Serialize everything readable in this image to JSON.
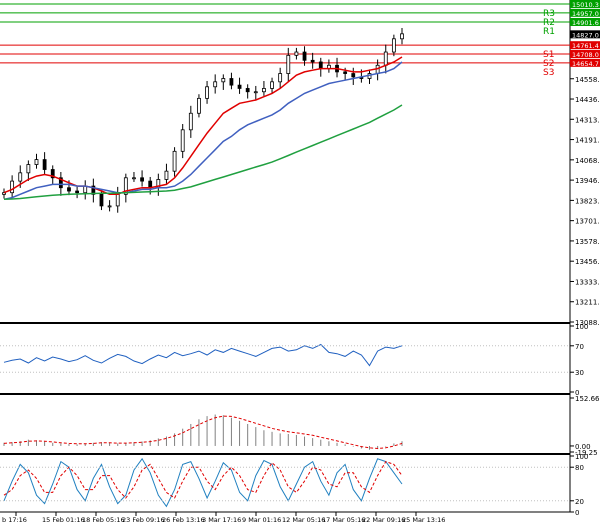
{
  "chart_data": [
    {
      "type": "line",
      "panel": "price",
      "x": [
        "b 17:16",
        "15 Feb 01:16",
        "18 Feb 05:16",
        "23 Feb 09:16",
        "26 Feb 13:16",
        "3 Mar 17:16",
        "9 Mar 01:16",
        "12 Mar 05:16",
        "17 Mar 05:16",
        "22 Mar 09:16",
        "25 Mar 13:16"
      ],
      "ylim": [
        13088.5,
        15010.3
      ],
      "yticks": [
        14558.5,
        14436.0,
        14313.5,
        14191.0,
        14068.5,
        13946.0,
        13823.5,
        13701.0,
        13578.5,
        13456.0,
        13333.5,
        13211.0,
        13088.5
      ],
      "price_bid_label": "14827.0",
      "series": [
        {
          "values": [
            13870,
            13940,
            13990,
            14040,
            14070,
            14010,
            13960,
            13900,
            13880,
            13870,
            13910,
            13860,
            13790,
            13790,
            13860,
            13960,
            13960,
            13940,
            13900,
            13950,
            14000,
            14120,
            14250,
            14350,
            14440,
            14510,
            14540,
            14560,
            14520,
            14500,
            14480,
            14480,
            14500,
            14540,
            14590,
            14700,
            14720,
            14670,
            14660,
            14620,
            14640,
            14600,
            14590,
            14570,
            14560,
            14590,
            14640,
            14720,
            14800,
            14830
          ]
        },
        {
          "values": [
            13870,
            13890,
            13920,
            13950,
            13970,
            13980,
            13970,
            13950,
            13930,
            13910,
            13910,
            13900,
            13880,
            13860,
            13860,
            13880,
            13890,
            13900,
            13900,
            13910,
            13920,
            13960,
            14020,
            14090,
            14160,
            14230,
            14290,
            14350,
            14380,
            14410,
            14420,
            14430,
            14450,
            14470,
            14500,
            14540,
            14580,
            14600,
            14610,
            14620,
            14620,
            14620,
            14610,
            14600,
            14600,
            14610,
            14620,
            14640,
            14660,
            14690
          ]
        },
        {
          "values": [
            13830,
            13840,
            13860,
            13880,
            13900,
            13910,
            13920,
            13920,
            13920,
            13910,
            13910,
            13900,
            13890,
            13880,
            13870,
            13870,
            13880,
            13890,
            13890,
            13900,
            13900,
            13910,
            13940,
            13980,
            14030,
            14080,
            14130,
            14180,
            14210,
            14250,
            14280,
            14300,
            14320,
            14340,
            14370,
            14410,
            14440,
            14470,
            14490,
            14510,
            14530,
            14540,
            14550,
            14560,
            14570,
            14580,
            14590,
            14600,
            14620,
            14660
          ]
        },
        {
          "values": [
            13830,
            13832,
            13835,
            13840,
            13845,
            13850,
            13855,
            13858,
            13860,
            13862,
            13864,
            13865,
            13866,
            13867,
            13868,
            13870,
            13872,
            13874,
            13876,
            13878,
            13880,
            13885,
            13895,
            13905,
            13920,
            13935,
            13950,
            13965,
            13980,
            13995,
            14010,
            14025,
            14040,
            14055,
            14075,
            14095,
            14115,
            14135,
            14155,
            14175,
            14195,
            14215,
            14235,
            14255,
            14275,
            14295,
            14320,
            14345,
            14370,
            14400
          ]
        }
      ],
      "levels": [
        {
          "label": "R3",
          "value": 15010.3,
          "tag": "15010.3",
          "color": "#00a000"
        },
        {
          "label": "R2",
          "value": 14957.0,
          "tag": "14957.0",
          "color": "#00a000"
        },
        {
          "label": "R1",
          "value": 14901.6,
          "tag": "14901.6",
          "color": "#00a000"
        },
        {
          "label": "S1",
          "value": 14761.4,
          "tag": "14761.4",
          "color": "#e00000"
        },
        {
          "label": "S2",
          "value": 14708.0,
          "tag": "14708.0",
          "color": "#e00000"
        },
        {
          "label": "S3",
          "value": 14654.7,
          "tag": "14654.7",
          "color": "#e00000"
        }
      ],
      "colors": {
        "candle": "#000000",
        "ma_fast": "#e00000",
        "ma_mid": "#4060c0",
        "ma_slow": "#20a040",
        "level_tag_text": "#ffffff",
        "bid_tag_bg": "#000000"
      }
    },
    {
      "type": "line",
      "panel": "oscillator-1",
      "ylim": [
        0,
        100
      ],
      "yticks": [
        "100",
        "70",
        "30",
        "0"
      ],
      "series": [
        {
          "values": [
            45,
            48,
            50,
            44,
            52,
            47,
            53,
            50,
            46,
            49,
            55,
            48,
            44,
            51,
            57,
            54,
            47,
            43,
            50,
            56,
            52,
            60,
            55,
            58,
            62,
            56,
            64,
            60,
            66,
            62,
            58,
            54,
            60,
            66,
            68,
            62,
            64,
            70,
            66,
            72,
            60,
            58,
            54,
            62,
            56,
            40,
            62,
            68,
            66,
            70
          ],
          "color": "#2060c0"
        }
      ]
    },
    {
      "type": "bar",
      "panel": "oscillator-2",
      "ylim": [
        -19.25,
        152.66
      ],
      "yticks": [
        "152.66",
        "0.00",
        "-19.25"
      ],
      "series": [
        {
          "values": [
            10,
            12,
            15,
            20,
            18,
            14,
            10,
            8,
            6,
            5,
            8,
            10,
            12,
            10,
            8,
            10,
            12,
            14,
            18,
            24,
            30,
            40,
            55,
            70,
            85,
            95,
            100,
            98,
            90,
            80,
            70,
            60,
            50,
            45,
            40,
            38,
            35,
            30,
            25,
            20,
            15,
            10,
            5,
            -2,
            -8,
            -12,
            -10,
            -2,
            8,
            15
          ],
          "color": "#808080"
        },
        {
          "values": [
            8,
            10,
            12,
            15,
            16,
            15,
            13,
            10,
            8,
            7,
            7,
            8,
            10,
            10,
            9,
            9,
            10,
            12,
            14,
            18,
            24,
            32,
            42,
            55,
            68,
            80,
            90,
            95,
            94,
            88,
            80,
            72,
            64,
            56,
            50,
            45,
            42,
            38,
            34,
            28,
            22,
            16,
            10,
            4,
            -2,
            -6,
            -8,
            -6,
            0,
            8
          ],
          "color": "#e00000"
        }
      ]
    },
    {
      "type": "line",
      "panel": "oscillator-3",
      "ylim": [
        0,
        100
      ],
      "yticks": [
        "100",
        "80",
        "20",
        "0"
      ],
      "series": [
        {
          "values": [
            20,
            55,
            85,
            70,
            30,
            15,
            50,
            90,
            80,
            40,
            20,
            60,
            85,
            45,
            15,
            30,
            75,
            95,
            70,
            30,
            10,
            40,
            85,
            90,
            60,
            25,
            55,
            88,
            75,
            35,
            20,
            65,
            92,
            85,
            45,
            20,
            50,
            80,
            90,
            55,
            30,
            70,
            85,
            40,
            20,
            60,
            95,
            90,
            70,
            50
          ],
          "color": "#2080c0"
        },
        {
          "values": [
            30,
            40,
            65,
            75,
            60,
            35,
            35,
            65,
            80,
            65,
            40,
            40,
            65,
            65,
            40,
            25,
            45,
            75,
            85,
            60,
            35,
            25,
            55,
            80,
            80,
            55,
            40,
            65,
            80,
            65,
            40,
            35,
            65,
            88,
            75,
            45,
            35,
            55,
            80,
            75,
            50,
            45,
            70,
            70,
            45,
            35,
            65,
            90,
            85,
            65
          ],
          "color": "#e00000"
        }
      ]
    }
  ]
}
